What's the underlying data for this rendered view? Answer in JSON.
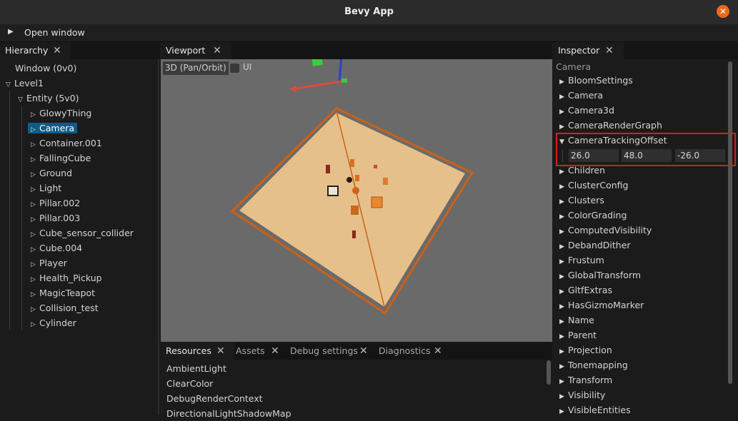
{
  "window": {
    "title": "Bevy App",
    "close_icon": "✕"
  },
  "menu": {
    "arrow_icon": "play-triangle-icon",
    "label": "Open window"
  },
  "hierarchy": {
    "tab": "Hierarchy",
    "rows": [
      {
        "label": "Window (0v0)",
        "selected": false
      },
      {
        "label": "Level1",
        "selected": false
      },
      {
        "label": "Entity (5v0)",
        "selected": false
      },
      {
        "label": "GlowyThing",
        "selected": false
      },
      {
        "label": "Camera",
        "selected": true
      },
      {
        "label": "Container.001",
        "selected": false
      },
      {
        "label": "FallingCube",
        "selected": false
      },
      {
        "label": "Ground",
        "selected": false
      },
      {
        "label": "Light",
        "selected": false
      },
      {
        "label": "Pillar.002",
        "selected": false
      },
      {
        "label": "Pillar.003",
        "selected": false
      },
      {
        "label": "Cube_sensor_collider",
        "selected": false
      },
      {
        "label": "Cube.004",
        "selected": false
      },
      {
        "label": "Player",
        "selected": false
      },
      {
        "label": "Health_Pickup",
        "selected": false
      },
      {
        "label": "MagicTeapot",
        "selected": false
      },
      {
        "label": "Collision_test",
        "selected": false
      },
      {
        "label": "Cylinder",
        "selected": false
      }
    ]
  },
  "viewport": {
    "tab": "Viewport",
    "mode_button": "3D (Pan/Orbit)",
    "ui_label": "UI",
    "gizmo_colors": {
      "x": "#e04a3a",
      "y": "#3ec83e",
      "z": "#2a3fd6"
    },
    "ground_color": "#e6c08a",
    "outline_color": "#c8621a"
  },
  "bottom": {
    "tabs": [
      "Resources",
      "Assets",
      "Debug settings",
      "Diagnostics"
    ],
    "active_tab": "Resources",
    "items": [
      "AmbientLight",
      "ClearColor",
      "DebugRenderContext",
      "DirectionalLightShadowMap"
    ]
  },
  "inspector": {
    "tab": "Inspector",
    "entity": "Camera",
    "components": [
      "BloomSettings",
      "Camera",
      "Camera3d",
      "CameraRenderGraph",
      "CameraTrackingOffset",
      "Children",
      "ClusterConfig",
      "Clusters",
      "ColorGrading",
      "ComputedVisibility",
      "DebandDither",
      "Frustum",
      "GlobalTransform",
      "GltfExtras",
      "HasGizmoMarker",
      "Name",
      "Parent",
      "Projection",
      "Tonemapping",
      "Transform",
      "Visibility",
      "VisibleEntities"
    ],
    "expanded": "CameraTrackingOffset",
    "offset_values": [
      "26.0",
      "48.0",
      "-26.0"
    ]
  }
}
